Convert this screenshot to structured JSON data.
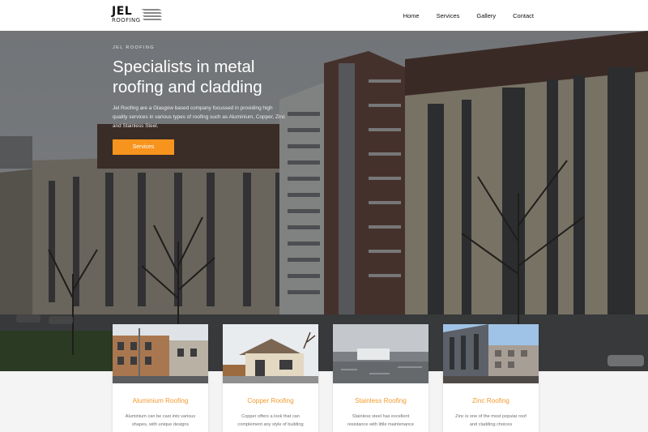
{
  "header": {
    "logo_text": "JEL",
    "logo_sub": "ROOFING",
    "nav": [
      "Home",
      "Services",
      "Gallery",
      "Contact"
    ]
  },
  "hero": {
    "eyebrow": "JEL ROOFING",
    "headline": "Specialists in metal roofing and cladding",
    "lead": "Jel Roofing are a Glasgow based company focussed in providing high quality services in various types of roofing such as Aluminium, Copper, Zinc and Stainless Steel.",
    "cta_label": "Services"
  },
  "cards": [
    {
      "title": "Aluminium Roofing",
      "desc": "Aluminium can be cast into various shapes, with unique designs"
    },
    {
      "title": "Copper Roofing",
      "desc": "Copper offers a look that can complement any style of building"
    },
    {
      "title": "Stainless Roofing",
      "desc": "Stainless steel has excellent resistance with little maintenance"
    },
    {
      "title": "Zinc Roofing",
      "desc": "Zinc is one of the most popular roof and cladding choices"
    }
  ],
  "colors": {
    "accent": "#f7941d",
    "card_title": "#f39a2f"
  }
}
